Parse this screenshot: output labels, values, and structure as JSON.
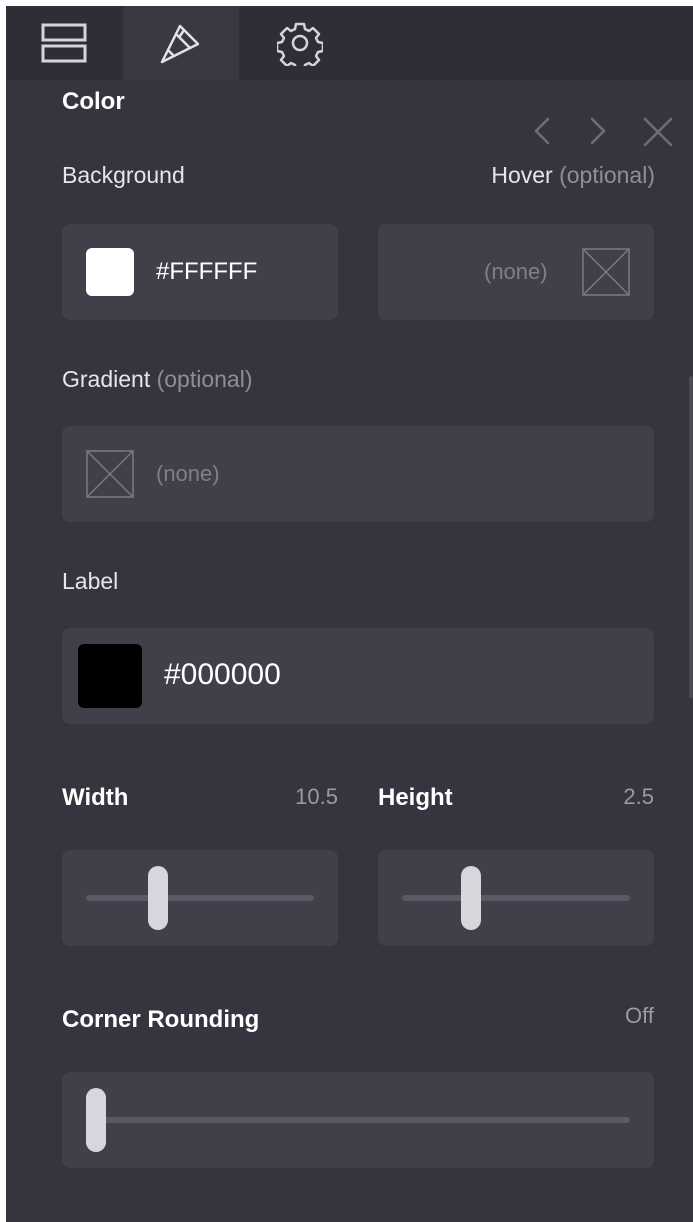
{
  "tabs": [
    {
      "icon": "layout-icon",
      "active": false
    },
    {
      "icon": "brush-icon",
      "active": true
    },
    {
      "icon": "gear-icon",
      "active": false
    }
  ],
  "section": {
    "title": "Color"
  },
  "background": {
    "label": "Background",
    "value": "#FFFFFF",
    "swatch_color": "#FFFFFF"
  },
  "hover": {
    "label": "Hover",
    "optional": "(optional)",
    "value": "(none)"
  },
  "gradient": {
    "label": "Gradient",
    "optional": "(optional)",
    "value": "(none)"
  },
  "label_color": {
    "label": "Label",
    "value": "#000000",
    "swatch_color": "#000000"
  },
  "width": {
    "label": "Width",
    "value": "10.5",
    "slider_fraction": 0.33
  },
  "height": {
    "label": "Height",
    "value": "2.5",
    "slider_fraction": 0.3
  },
  "corner_rounding": {
    "label": "Corner Rounding",
    "value": "Off",
    "slider_fraction": 0.0
  },
  "nav": {
    "prev": "chevron-left-icon",
    "next": "chevron-right-icon",
    "close": "close-icon"
  }
}
